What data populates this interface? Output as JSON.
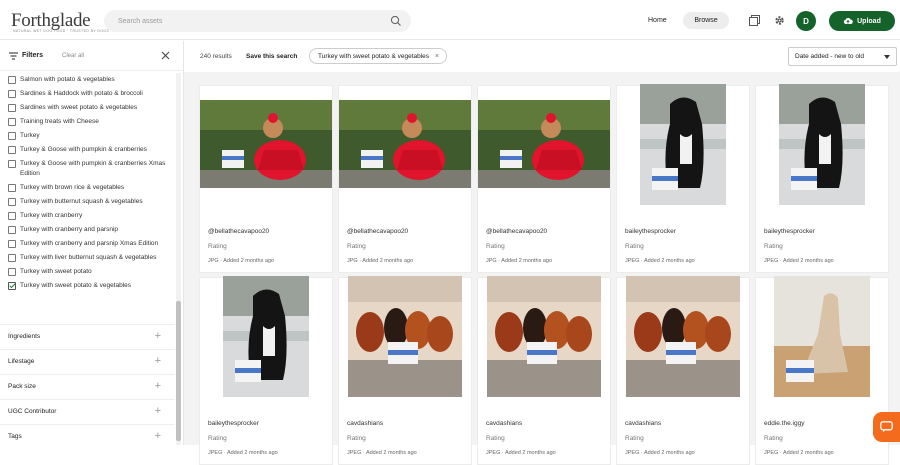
{
  "header": {
    "logo": "Forthglade",
    "logo_tagline": "NATURAL WET DOG FOOD · TRUSTED BY DOGS",
    "search_placeholder": "Search assets",
    "nav_home": "Home",
    "nav_browse": "Browse",
    "avatar_initial": "D",
    "upload_label": "Upload"
  },
  "filters": {
    "title": "Filters",
    "clear_all": "Clear all",
    "items": [
      {
        "label": "Salmon with potato & vegetables",
        "checked": false
      },
      {
        "label": "Sardines & Haddock with potato & broccoli",
        "checked": false
      },
      {
        "label": "Sardines with sweet potato & vegetables",
        "checked": false
      },
      {
        "label": "Training treats with Cheese",
        "checked": false
      },
      {
        "label": "Turkey",
        "checked": false
      },
      {
        "label": "Turkey & Goose with pumpkin & cranberries",
        "checked": false
      },
      {
        "label": "Turkey & Goose with pumpkin & cranberries Xmas Edition",
        "checked": false
      },
      {
        "label": "Turkey with brown rice & vegetables",
        "checked": false
      },
      {
        "label": "Turkey with butternut squash & vegetables",
        "checked": false
      },
      {
        "label": "Turkey with cranberry",
        "checked": false
      },
      {
        "label": "Turkey with cranberry and parsnip",
        "checked": false
      },
      {
        "label": "Turkey with cranberry and parsnip Xmas Edition",
        "checked": false
      },
      {
        "label": "Turkey with liver butternut squash & vegetables",
        "checked": false
      },
      {
        "label": "Turkey with sweet potato",
        "checked": false
      },
      {
        "label": "Turkey with sweet potato & vegetables",
        "checked": true
      }
    ],
    "sections": [
      "Ingredients",
      "Lifestage",
      "Pack size",
      "UGC Contributor",
      "Tags"
    ]
  },
  "toolbar": {
    "results": "240 results",
    "save_search": "Save this search",
    "active_filter": "Turkey with sweet potato & vegetables",
    "sort": "Date added - new to old"
  },
  "assets": [
    {
      "name": "@bellathecavapoo20",
      "rating": "Rating",
      "meta": "JPG · Added 2 months ago",
      "scene": "red"
    },
    {
      "name": "@bellathecavapoo20",
      "rating": "Rating",
      "meta": "JPG · Added 2 months ago",
      "scene": "red"
    },
    {
      "name": "@bellathecavapoo20",
      "rating": "Rating",
      "meta": "JPG · Added 2 months ago",
      "scene": "red"
    },
    {
      "name": "baileythesprocker",
      "rating": "Rating",
      "meta": "JPEG · Added 2 months ago",
      "scene": "snow"
    },
    {
      "name": "baileythesprocker",
      "rating": "Rating",
      "meta": "JPEG · Added 2 months ago",
      "scene": "snow"
    },
    {
      "name": "baileythesprocker",
      "rating": "Rating",
      "meta": "JPEG · Added 2 months ago",
      "scene": "snow"
    },
    {
      "name": "cavdashians",
      "rating": "Rating",
      "meta": "JPEG · Added 2 months ago",
      "scene": "cav"
    },
    {
      "name": "cavdashians",
      "rating": "Rating",
      "meta": "JPEG · Added 2 months ago",
      "scene": "cav"
    },
    {
      "name": "cavdashians",
      "rating": "Rating",
      "meta": "JPEG · Added 2 months ago",
      "scene": "cav"
    },
    {
      "name": "eddie.the.iggy",
      "rating": "Rating",
      "meta": "JPEG · Added 2 months ago",
      "scene": "iggy"
    }
  ],
  "colors": {
    "brand_green": "#15632b",
    "chat_orange": "#f56b1e"
  }
}
